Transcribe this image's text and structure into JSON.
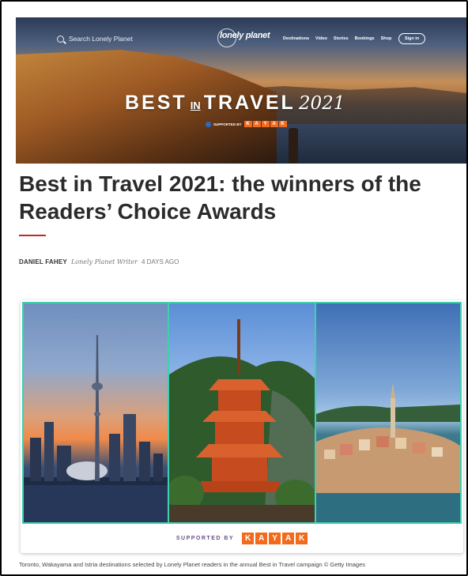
{
  "header": {
    "search_placeholder": "Search Lonely Planet",
    "logo_text": "lonely planet",
    "nav": [
      "Destinations",
      "Video",
      "Stories",
      "Bookings",
      "Shop"
    ],
    "sign_in": "Sign in"
  },
  "hero": {
    "title_left": "BEST",
    "title_in": "IN",
    "title_right": "TRAVEL",
    "year": "2021",
    "sponsor_label": "SUPPORTED BY",
    "sponsor_letters": [
      "K",
      "A",
      "Y",
      "A",
      "K"
    ]
  },
  "article": {
    "headline": "Best in Travel 2021: the winners of the Readers’ Choice Awards",
    "author": "DANIEL FAHEY",
    "role": "Lonely Planet Writer",
    "date": "4 DAYS AGO"
  },
  "collage": {
    "sponsor_label": "SUPPORTED BY",
    "sponsor_letters": [
      "K",
      "A",
      "Y",
      "A",
      "K"
    ],
    "caption": "Toronto, Wakayama and Istria destinations selected by Lonely Planet readers in the annual Best in Travel campaign © Getty Images"
  },
  "colors": {
    "accent": "#c0292b",
    "kayak": "#f26b1d",
    "panel_border": "#3fd0b0"
  }
}
